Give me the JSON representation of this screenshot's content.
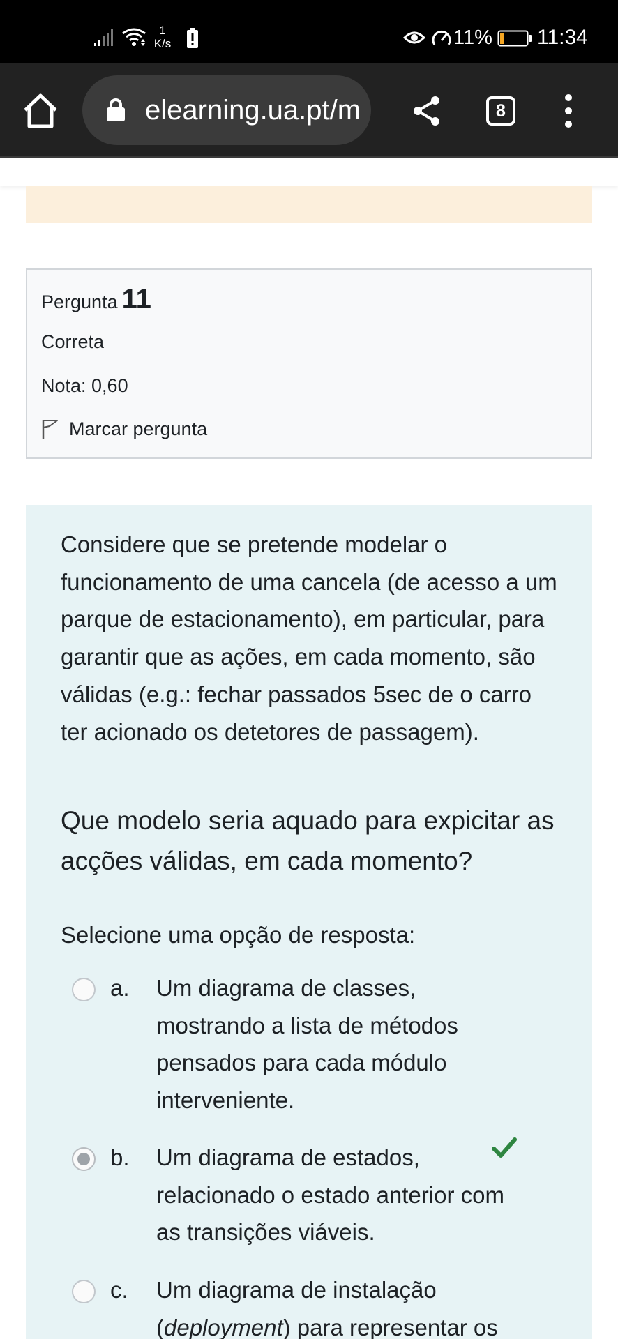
{
  "status_bar": {
    "network_speed_value": "1",
    "network_speed_unit": "K/s",
    "battery_percent": "11%",
    "time": "11:34"
  },
  "browser": {
    "url": "elearning.ua.pt/m",
    "tab_count": "8"
  },
  "question": {
    "label": "Pergunta",
    "number": "11",
    "state": "Correta",
    "grade": "Nota: 0,60",
    "flag_label": "Marcar pergunta",
    "text_paragraph_1": "Considere que se pretende modelar o funcionamento de uma cancela (de acesso a um parque de estacionamento), em particular, para garantir que as ações, em cada momento, são válidas (e.g.: fechar passados 5sec de o carro ter acionado os detetores de passagem).",
    "text_paragraph_2": "Que modelo seria aquado para expicitar as acções válidas, em cada momento?",
    "prompt": "Selecione uma opção de resposta:",
    "options": [
      {
        "letter": "a.",
        "text": "Um diagrama de classes, mostrando a lista de métodos pensados para cada módulo interveniente.",
        "selected": false
      },
      {
        "letter": "b.",
        "text": "Um diagrama de estados, relacionado o estado anterior com as transições viáveis.",
        "selected": true,
        "correct": true
      },
      {
        "letter": "c.",
        "text_before": "Um diagrama de instalação (",
        "text_emphasis": "deployment",
        "text_after": ") para representar os",
        "selected": false
      }
    ]
  },
  "colors": {
    "status_bar_bg": "#000000",
    "toolbar_bg": "#222222",
    "warning_panel": "#fcefdc",
    "question_body_bg": "#e7f3f5",
    "correct_check": "#2e8540"
  }
}
